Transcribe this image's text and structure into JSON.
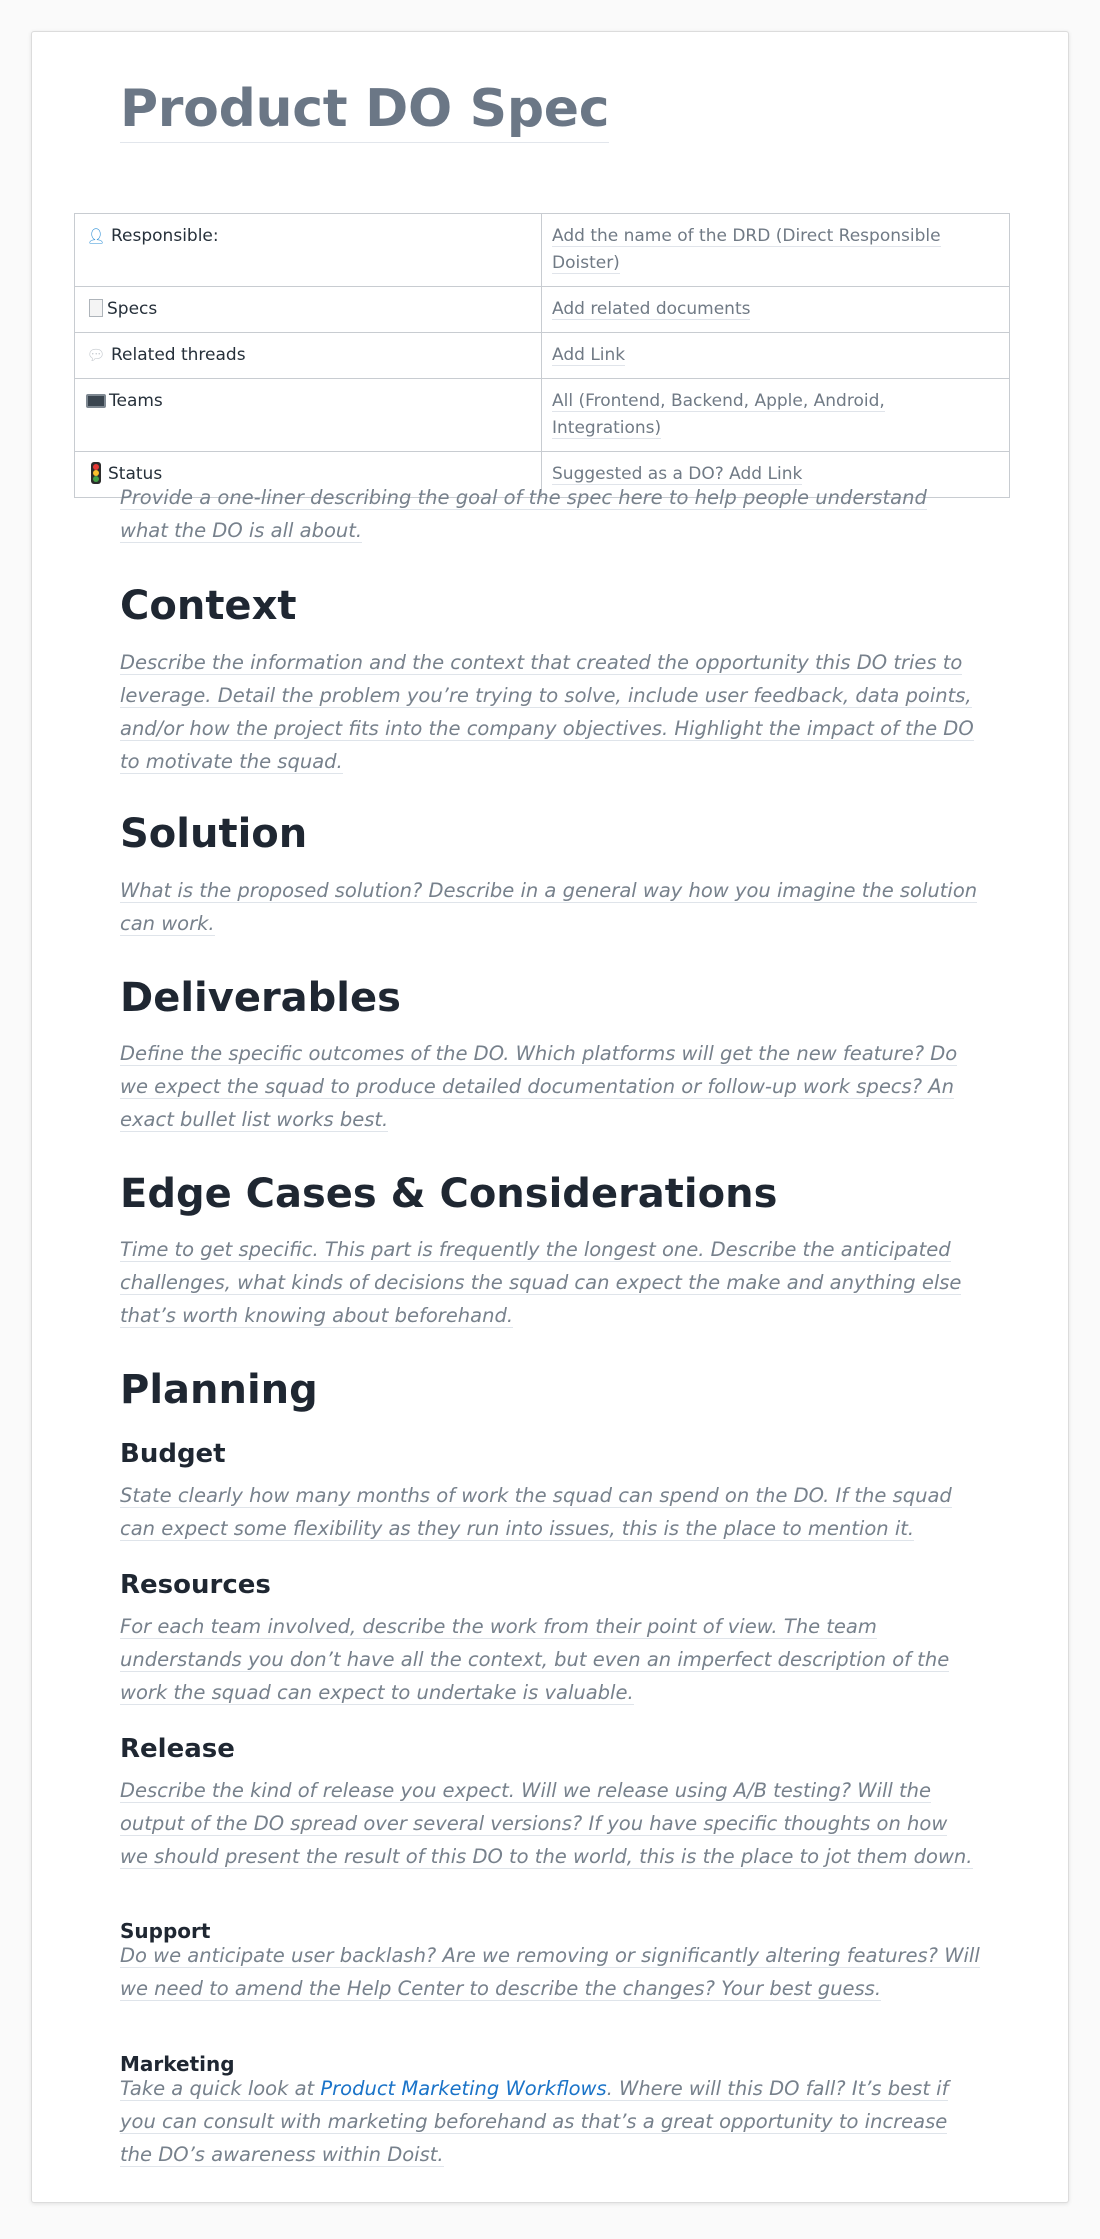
{
  "title": "Product DO Spec",
  "meta_table": [
    {
      "label": "Responsible:",
      "value": "Add the name of the DRD (Direct Responsible Doister)",
      "icon": "person-icon"
    },
    {
      "label": "Specs",
      "value": "Add related documents",
      "icon": "document-icon"
    },
    {
      "label": "Related threads",
      "value": "Add Link",
      "icon": "speech-bubble-icon"
    },
    {
      "label": "Teams",
      "value": "All (Frontend, Backend, Apple, Android, Integrations)",
      "icon": "monitor-icon"
    },
    {
      "label": "Status",
      "value": "Suggested as a DO? Add Link",
      "icon": "traffic-light-icon"
    }
  ],
  "intro": "Provide a one-liner describing the goal of the spec here to help people understand what the DO is all about.",
  "sections": {
    "context": {
      "heading": "Context",
      "text": "Describe the information and the context that created the opportunity this DO tries to leverage. Detail the problem you’re trying to solve, include user feedback, data points, and/or how the project fits into the company objectives. Highlight the impact of the DO to motivate the squad."
    },
    "solution": {
      "heading": "Solution",
      "text": "What is the proposed solution? Describe in a general way how you imagine the solution can work."
    },
    "deliverables": {
      "heading": "Deliverables",
      "text": "Define the specific outcomes of the DO. Which platforms will get the new feature? Do we expect the squad to produce detailed documentation or follow-up work specs? An exact bullet list works best."
    },
    "edge_cases": {
      "heading": "Edge Cases & Considerations",
      "text": "Time to get specific. This part is frequently the longest one. Describe the anticipated challenges, what kinds of decisions the squad can expect the make and anything else that’s worth knowing about beforehand."
    },
    "planning": {
      "heading": "Planning",
      "budget": {
        "heading": "Budget",
        "text": "State clearly how many months of work the squad can spend on the DO. If the squad can expect some flexibility as they run into issues, this is the place to mention it."
      },
      "resources": {
        "heading": "Resources",
        "text": "For each team involved, describe the work from their point of view. The team understands you don’t have all the context, but even an imperfect description of the work the squad can expect to undertake is valuable."
      },
      "release": {
        "heading": "Release",
        "text": "Describe the kind of release you expect. Will we release using A/B testing? Will the output of the DO spread over several versions? If you have specific thoughts on how we should present the result of this DO to the world, this is the place to jot them down."
      },
      "support": {
        "heading": "Support",
        "text": "Do we anticipate user backlash? Are we removing or significantly altering features? Will we need to amend the Help Center to describe the changes? Your best guess."
      },
      "marketing": {
        "heading": "Marketing",
        "text_before": "Take a quick look at ",
        "link": "Product Marketing Workflows",
        "text_after": ". Where will this DO fall? It’s best if you can consult with marketing beforehand as that’s a great opportunity to increase the DO’s awareness within Doist."
      }
    }
  },
  "colors": {
    "title": "#6b7786",
    "heading": "#1f2732",
    "body_italic": "#77818c",
    "link": "#1a73c8",
    "table_border": "#c8ccd1"
  }
}
